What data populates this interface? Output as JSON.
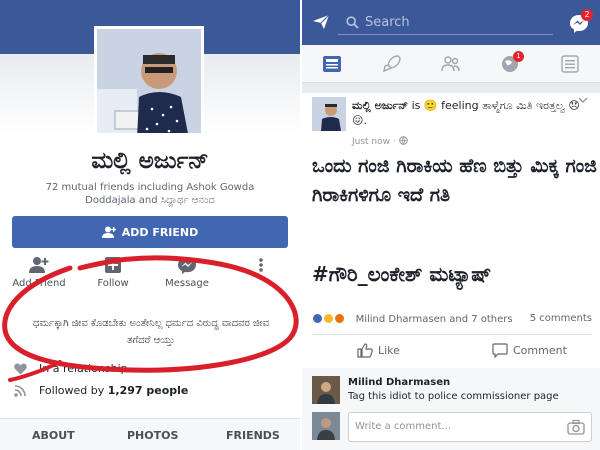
{
  "left": {
    "name": "ಮಲ್ಲಿ ಅರ್ಜುನ್",
    "mutual": "72 mutual friends including Ashok Gowda Doddajala and ಸಿದ್ದಾರ್ಥ ಆನಂದ",
    "add_friend": "ADD FRIEND",
    "actions": [
      "Add Friend",
      "Follow",
      "Message"
    ],
    "about": "ಧರ್ಮಕ್ಕಾಗಿ ಜೀವ ಕೊಡಬೇಕು ಅಂತೇನಿಲ್ಲ ಧರ್ಮದ ವಿರುದ್ಧ ವಾದವರ ಜೀವ ತಗೆದರೆ ಆಯ್ತು",
    "relationship": "In a relationship",
    "followed_prefix": "Followed by",
    "followers": "1,297 people",
    "tabs": [
      "ABOUT",
      "PHOTOS",
      "FRIENDS"
    ]
  },
  "right": {
    "search_placeholder": "Search",
    "messages_badge": "2",
    "notifications_badge": "1",
    "post": {
      "author": "ಮಲ್ಲಿ ಅರ್ಜುನ್",
      "feeling": "is 🙂 feeling ತಾಳ್ಮೆಗೂ ಮಿತಿ ಇರತ್ತಲ್ವ 😞😖.",
      "time": "Just now · ",
      "body": "ಒಂದು ಗಂಜಿ ಗಿರಾಕಿಯ ಹೆಣ ಬಿತ್ತು ಮಿಕ್ಕ ಗಂಜಿ ಗಿರಾಕಿಗಳಿಗೂ ಇದೆ ಗತಿ",
      "hashtag": "#ಗೌರಿ_ಲಂಕೇಶ್ ಮಟ್ಯಾಷ್",
      "reactions_text": "Milind Dharmasen and 7 others",
      "comments_count": "5 comments",
      "like": "Like",
      "comment": "Comment"
    },
    "comment": {
      "name": "Milind Dharmasen",
      "text": "Tag this idiot to police commissioner page"
    },
    "write_placeholder": "Write a comment..."
  },
  "colors": {
    "facebook_blue": "#3b5998",
    "button_blue": "#4267b2",
    "annotation_red": "#d81f2a"
  }
}
